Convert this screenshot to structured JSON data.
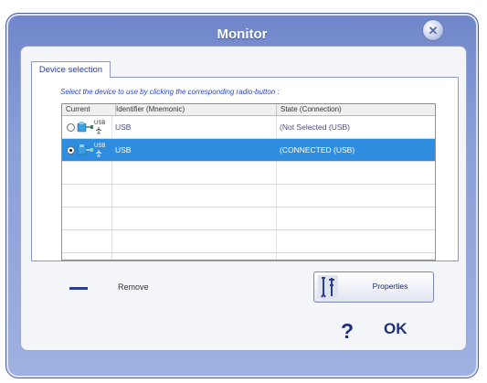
{
  "window": {
    "title": "Monitor",
    "close_glyph": "✕"
  },
  "tabs": [
    {
      "label": "Device selection"
    }
  ],
  "instruction": "Select the device to use by clicking the corresponding radio-button :",
  "table": {
    "headers": [
      "Current",
      "Identifier (Mnemonic)",
      "State (Connection)"
    ],
    "rows": [
      {
        "selected": false,
        "icon": "usb-device-icon",
        "icon_text": "USB",
        "identifier": "USB",
        "state": "(Not Selected (USB)"
      },
      {
        "selected": true,
        "icon": "usb-device-icon",
        "icon_text": "USB",
        "identifier": "USB",
        "state": "(CONNECTED (USB)"
      }
    ]
  },
  "actions": {
    "remove_label": "Remove",
    "properties_label": "Properties",
    "help_label": "?",
    "ok_label": "OK"
  },
  "colors": {
    "window_frame": "#8a9fd8",
    "selection": "#2f8de0",
    "accent_text": "#1e2f7c"
  }
}
